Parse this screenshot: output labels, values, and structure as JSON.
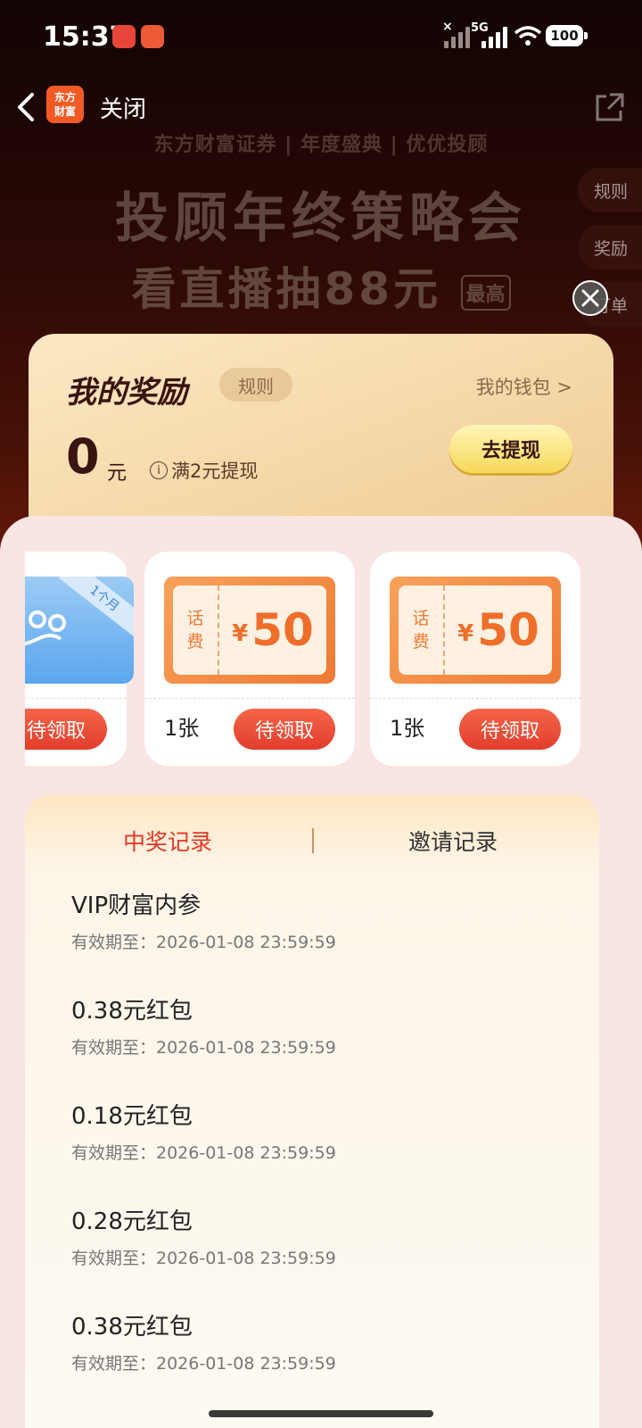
{
  "status_bar": {
    "time": "15:37",
    "network": "5G",
    "battery": "100"
  },
  "nav": {
    "brand_line1": "东方",
    "brand_line2": "财富",
    "close_label": "关闭"
  },
  "banner": {
    "subtitle": "东方财富证券 | 年度盛典 | 优优投顾",
    "title": "投顾年终策略会",
    "subtitle2": "看直播抽88元",
    "badge": "最高"
  },
  "side_buttons": [
    "规则",
    "奖励",
    "订单"
  ],
  "rewards": {
    "title": "我的奖励",
    "rules_tag": "规则",
    "wallet_link": "我的钱包 >",
    "amount": "0",
    "unit": "元",
    "note": "满2元提现",
    "withdraw_button": "去提现"
  },
  "coupons": [
    {
      "type": "vip",
      "ribbon": "1个月",
      "claim_label": "待领取"
    },
    {
      "type": "phone",
      "label_top": "话",
      "label_bottom": "费",
      "currency": "¥",
      "value": "50",
      "qty": "1张",
      "claim_label": "待领取"
    },
    {
      "type": "phone",
      "label_top": "话",
      "label_bottom": "费",
      "currency": "¥",
      "value": "50",
      "qty": "1张",
      "claim_label": "待领取"
    }
  ],
  "records": {
    "tabs": [
      "中奖记录",
      "邀请记录"
    ],
    "items": [
      {
        "name": "VIP财富内参",
        "expiry": "有效期至：2026-01-08 23:59:59"
      },
      {
        "name": "0.38元红包",
        "expiry": "有效期至：2026-01-08 23:59:59"
      },
      {
        "name": "0.18元红包",
        "expiry": "有效期至：2026-01-08 23:59:59"
      },
      {
        "name": "0.28元红包",
        "expiry": "有效期至：2026-01-08 23:59:59"
      },
      {
        "name": "0.38元红包",
        "expiry": "有效期至：2026-01-08 23:59:59"
      }
    ]
  },
  "colors": {
    "accent_red": "#e2372a",
    "coupon_orange": "#ee7a34",
    "gold": "#f7d85a"
  }
}
